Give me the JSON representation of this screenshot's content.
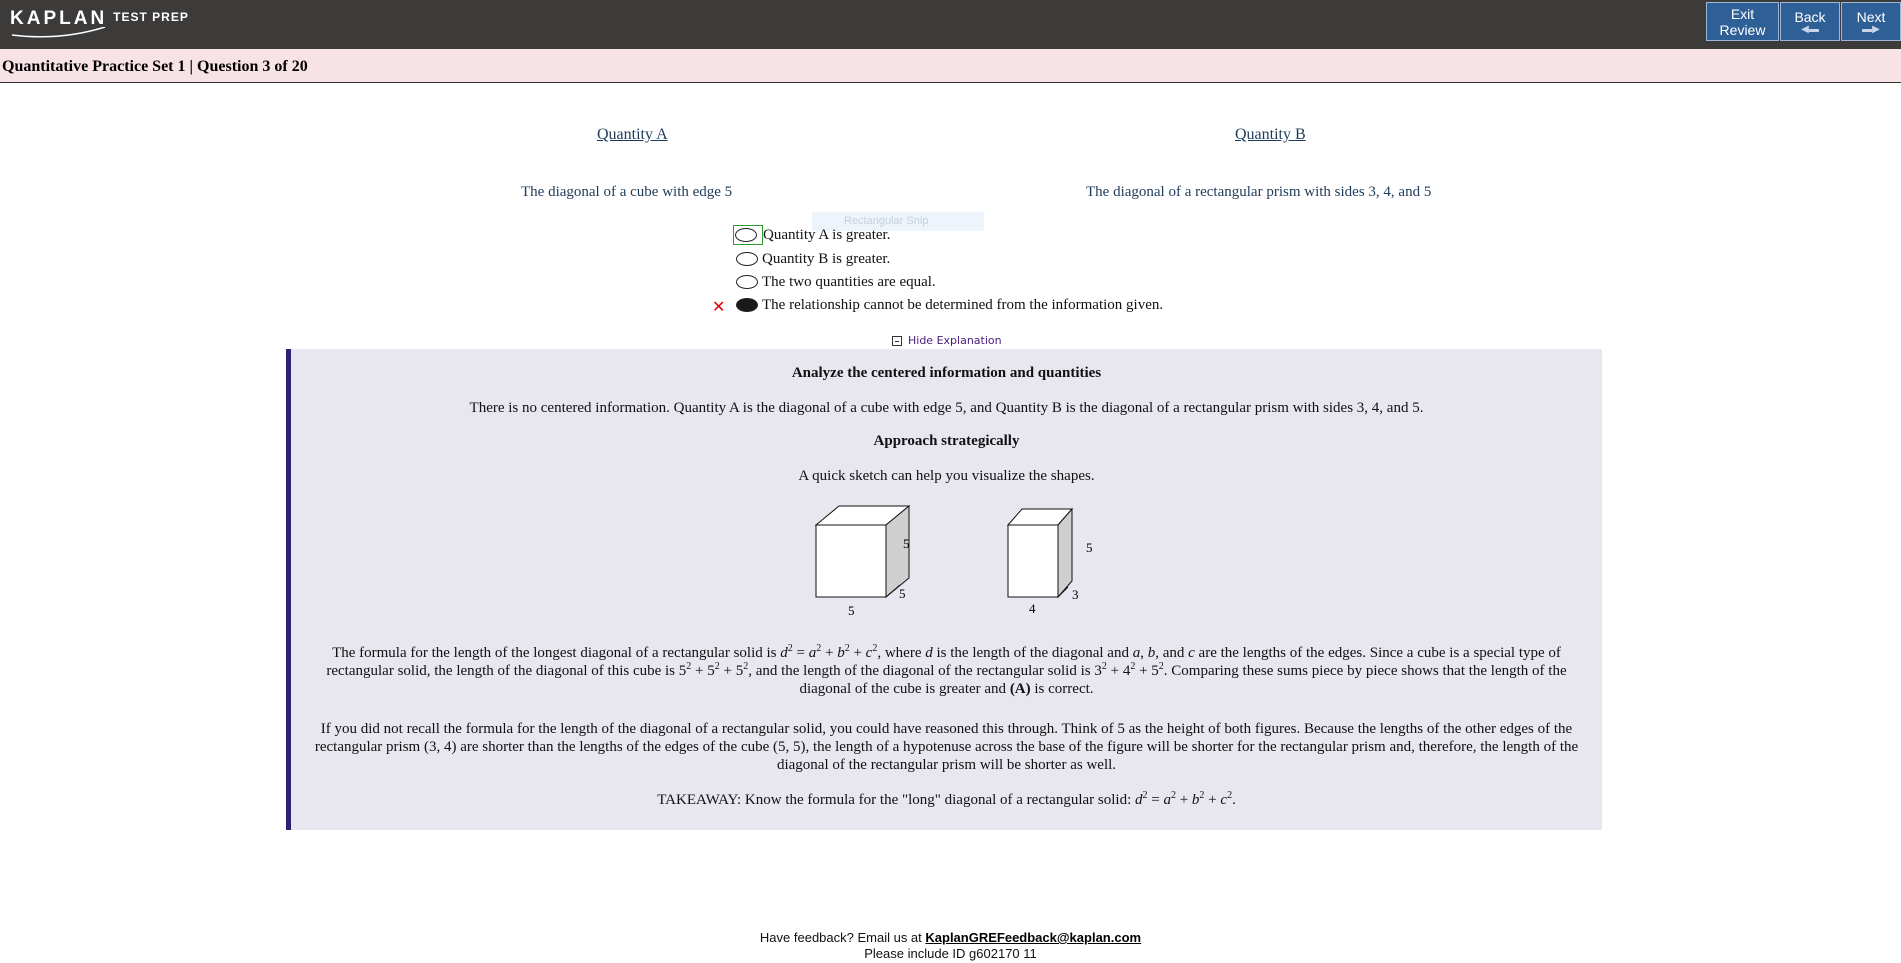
{
  "header": {
    "logo_brand": "KAPLAN",
    "logo_sub": "TEST PREP",
    "buttons": {
      "exit_line1": "Exit",
      "exit_line2": "Review",
      "back": "Back",
      "next": "Next"
    }
  },
  "title": "Quantitative Practice Set 1 | Question 3 of 20",
  "question": {
    "quantity_a_label": "Quantity A",
    "quantity_b_label": "Quantity B",
    "quantity_a_text": "The diagonal of a cube with edge 5",
    "quantity_b_text": "The diagonal of a rectangular prism with sides 3, 4, and 5"
  },
  "snip_ghost": "Rectangular Snip",
  "choices": [
    {
      "label": "Quantity A is greater.",
      "selected": false,
      "focused": true
    },
    {
      "label": "Quantity B is greater.",
      "selected": false,
      "focused": false
    },
    {
      "label": "The two quantities are equal.",
      "selected": false,
      "focused": false
    },
    {
      "label": "The relationship cannot be determined from the information given.",
      "selected": true,
      "incorrect": true
    }
  ],
  "incorrect_mark": "✕",
  "hide_explanation": "Hide Explanation",
  "explanation": {
    "heading1": "Analyze the centered information and quantities",
    "para1": "There is no centered information. Quantity A is the diagonal of a cube with edge 5, and Quantity B is the diagonal of a rectangular prism with sides 3, 4, and 5.",
    "heading2": "Approach strategically",
    "para2": "A quick sketch can help you visualize the shapes.",
    "cube_labels": {
      "front_bottom": "5",
      "side": "5",
      "depth": "5"
    },
    "prism_labels": {
      "front_bottom": "4",
      "side": "5",
      "depth": "3"
    },
    "para3_a": "The formula for the length of the longest diagonal of a rectangular solid is ",
    "para3_b": ", where ",
    "para3_c": " is the length of the diagonal and ",
    "para3_d": " are the lengths of the edges. Since a cube is a special type of rectangular solid, the length of the diagonal of this cube is ",
    "para3_e": ", and the length of the diagonal of the rectangular solid is ",
    "para3_f": ". Comparing these sums piece by piece shows that the length of the diagonal of the cube is greater and ",
    "para3_g": "(A)",
    "para3_h": " is correct.",
    "para4": "If you did not recall the formula for the length of the diagonal of a rectangular solid, you could have reasoned this through. Think of 5 as the height of both figures. Because the lengths of the other edges of the rectangular prism (3, 4) are shorter than the lengths of the edges of the cube (5, 5), the length of a hypotenuse across the base of the figure will be shorter for the rectangular prism and, therefore, the length of the diagonal of the rectangular prism will be shorter as well.",
    "takeaway_prefix": "TAKEAWAY: Know the formula for the \"long\" diagonal of a rectangular solid: "
  },
  "footer": {
    "line1_prefix": "Have feedback? Email us at ",
    "email": "KaplanGREFeedback@kaplan.com",
    "line2": "Please include ID g602170  11"
  }
}
